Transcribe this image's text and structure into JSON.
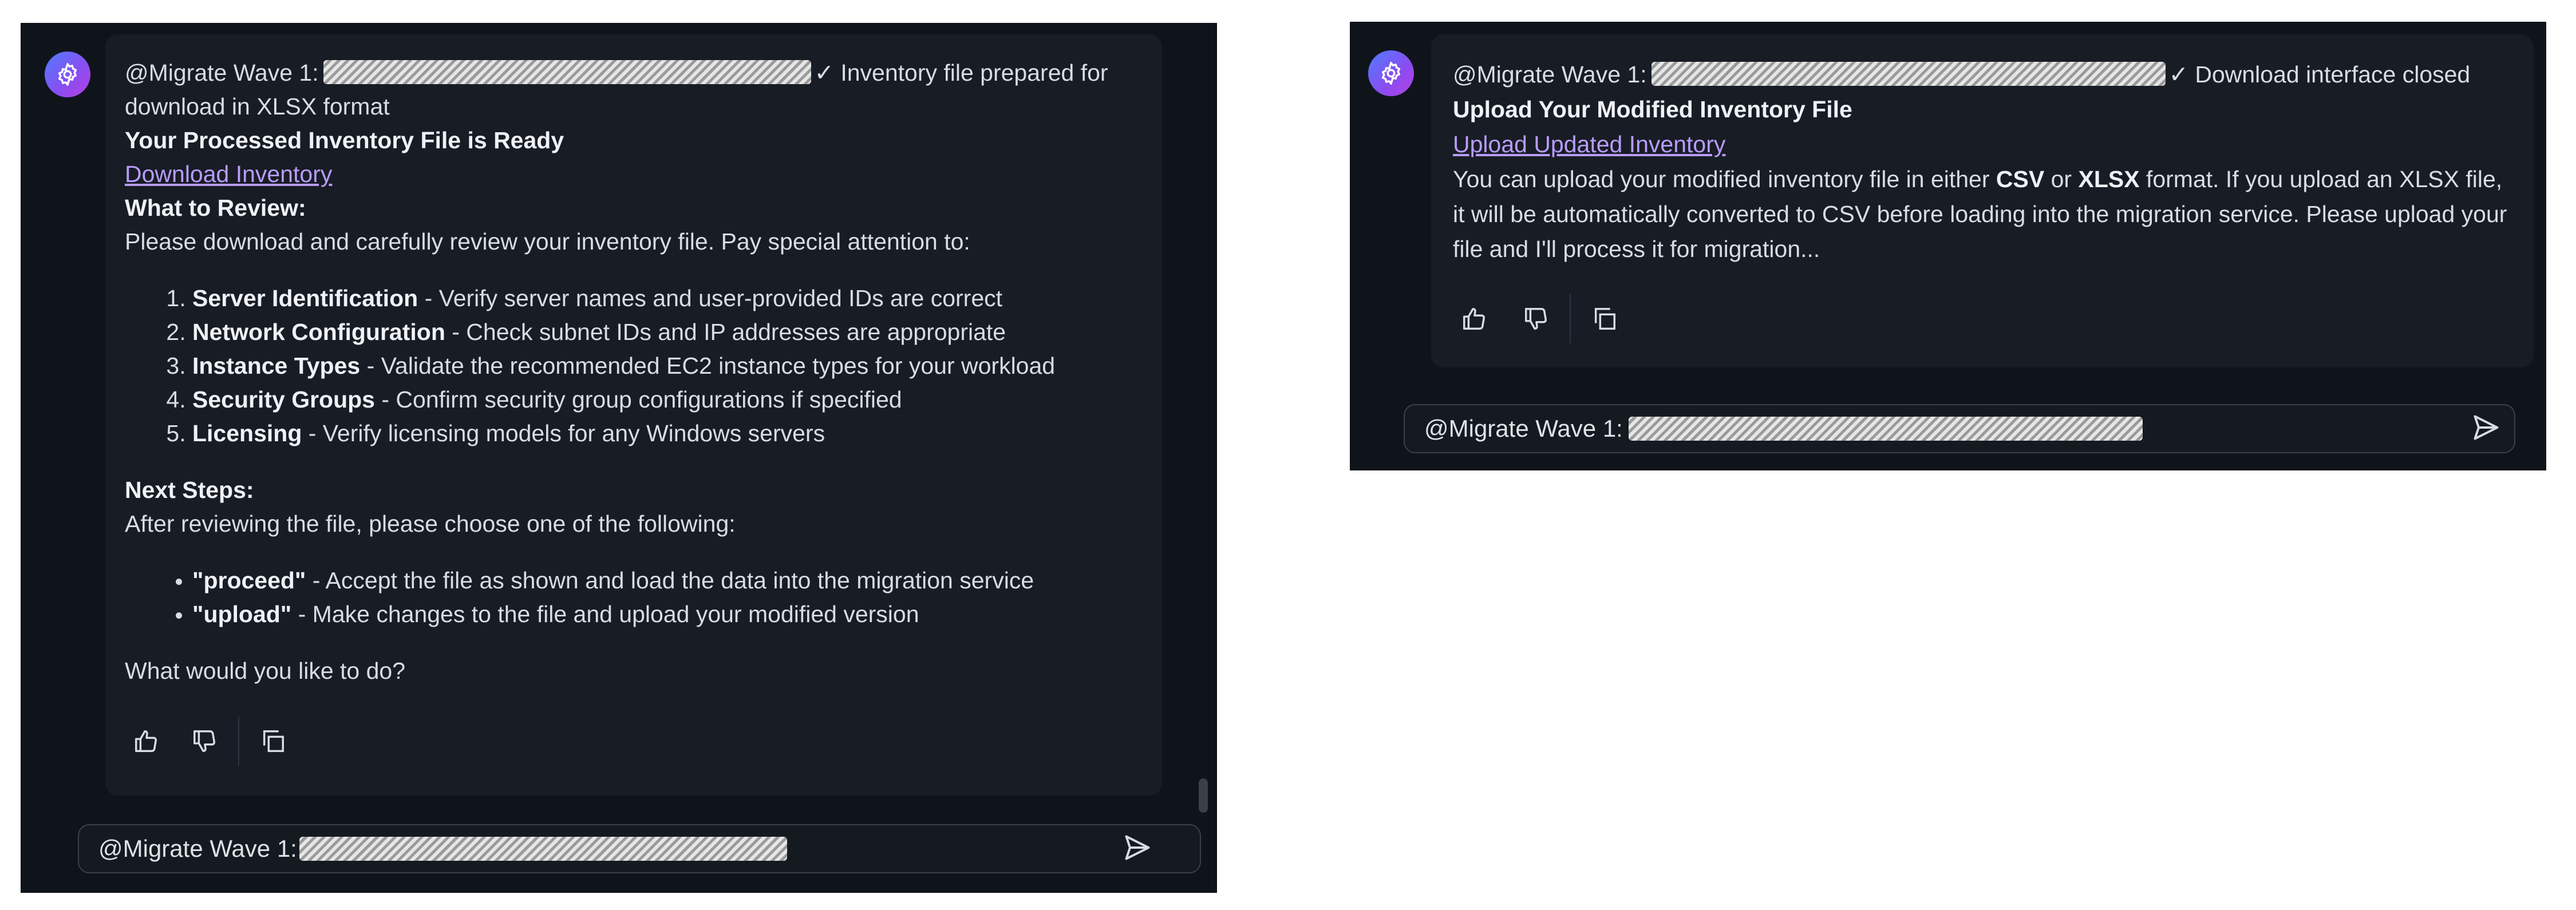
{
  "left": {
    "prefix": "@Migrate Wave 1:",
    "status": "✓ Inventory file prepared for download in XLSX format",
    "heading": "Your Processed Inventory File is Ready",
    "download_link": "Download Inventory",
    "review_heading": "What to Review:",
    "review_intro": "Please download and carefully review your inventory file. Pay special attention to:",
    "review_items": [
      {
        "title": "Server Identification",
        "text": " - Verify server names and user-provided IDs are correct"
      },
      {
        "title": "Network Configuration",
        "text": " - Check subnet IDs and IP addresses are appropriate"
      },
      {
        "title": "Instance Types",
        "text": " - Validate the recommended EC2 instance types for your workload"
      },
      {
        "title": "Security Groups",
        "text": " - Confirm security group configurations if specified"
      },
      {
        "title": "Licensing",
        "text": " - Verify licensing models for any Windows servers"
      }
    ],
    "next_heading": "Next Steps:",
    "next_intro": "After reviewing the file, please choose one of the following:",
    "options": [
      {
        "title": "\"proceed\"",
        "text": " - Accept the file as shown and load the data into the migration service"
      },
      {
        "title": "\"upload\"",
        "text": " - Make changes to the file and upload your modified version"
      }
    ],
    "question": "What would you like to do?",
    "input_prefix": "@Migrate Wave 1:"
  },
  "right": {
    "prefix": "@Migrate Wave 1:",
    "status": "✓ Download interface closed",
    "heading": "Upload Your Modified Inventory File",
    "upload_link": "Upload Updated Inventory",
    "body_1": "You can upload your modified inventory file in either ",
    "csv": "CSV",
    "or": " or ",
    "xlsx": "XLSX",
    "body_2": " format. If you upload an XLSX file, it will be automatically converted to CSV before loading into the migration service. Please upload your file and I'll process it for migration...",
    "input_prefix": "@Migrate Wave 1:"
  },
  "icons": [
    "assistant-avatar-icon",
    "thumbs-up-icon",
    "thumbs-down-icon",
    "copy-icon",
    "send-icon"
  ],
  "colors": {
    "background": "#0f141b",
    "card": "#181c24",
    "link": "#b89cff",
    "avatar_start": "#4f7cff",
    "avatar_end": "#b640e6"
  }
}
